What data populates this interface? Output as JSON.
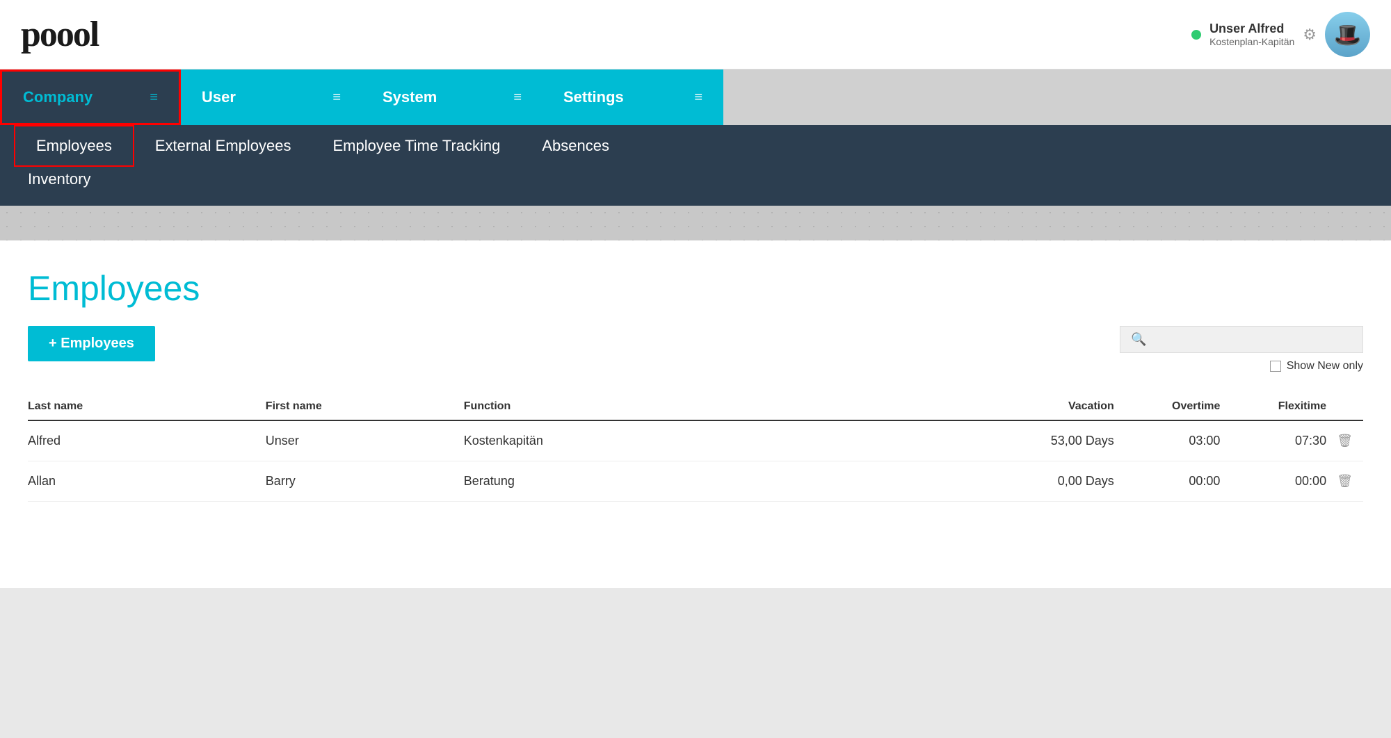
{
  "app": {
    "logo": "poool"
  },
  "header": {
    "user": {
      "name": "Unser Alfred",
      "role": "Kostenplan-Kapitän",
      "status": "online"
    }
  },
  "top_nav": {
    "tabs": [
      {
        "id": "company",
        "label": "Company",
        "active": true
      },
      {
        "id": "user",
        "label": "User",
        "active": false
      },
      {
        "id": "system",
        "label": "System",
        "active": false
      },
      {
        "id": "settings",
        "label": "Settings",
        "active": false
      }
    ]
  },
  "sub_nav": {
    "row1": [
      {
        "id": "employees",
        "label": "Employees",
        "active": true
      },
      {
        "id": "external-employees",
        "label": "External Employees",
        "active": false
      },
      {
        "id": "employee-time-tracking",
        "label": "Employee Time Tracking",
        "active": false
      },
      {
        "id": "absences",
        "label": "Absences",
        "active": false
      }
    ],
    "row2": [
      {
        "id": "inventory",
        "label": "Inventory",
        "active": false
      }
    ]
  },
  "page": {
    "title": "Employees",
    "add_button": "+ Employees",
    "search_placeholder": "",
    "show_new_only_label": "Show New only",
    "table": {
      "columns": [
        {
          "id": "lastname",
          "label": "Last name"
        },
        {
          "id": "firstname",
          "label": "First name"
        },
        {
          "id": "function",
          "label": "Function"
        },
        {
          "id": "vacation",
          "label": "Vacation"
        },
        {
          "id": "overtime",
          "label": "Overtime"
        },
        {
          "id": "flexitime",
          "label": "Flexitime"
        }
      ],
      "rows": [
        {
          "lastname": "Alfred",
          "firstname": "Unser",
          "function": "Kostenkapitän",
          "vacation": "53,00 Days",
          "overtime": "03:00",
          "flexitime": "07:30"
        },
        {
          "lastname": "Allan",
          "firstname": "Barry",
          "function": "Beratung",
          "vacation": "0,00 Days",
          "overtime": "00:00",
          "flexitime": "00:00"
        }
      ]
    }
  }
}
